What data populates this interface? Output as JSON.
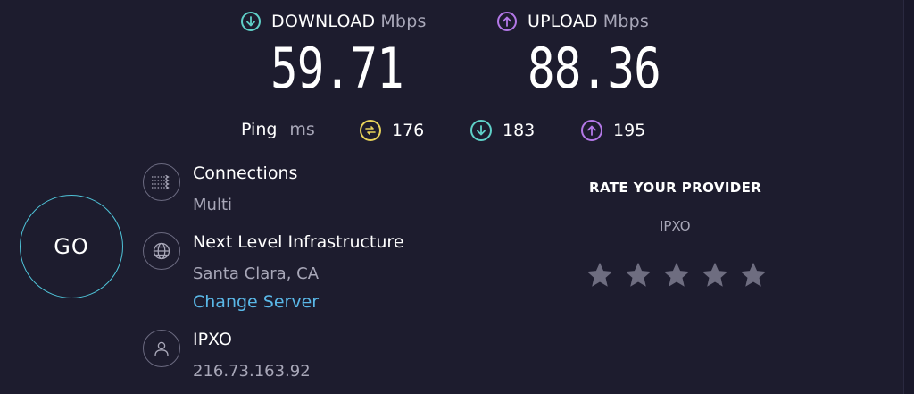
{
  "download": {
    "label": "DOWNLOAD",
    "unit": "Mbps",
    "value": "59.71",
    "color": "#5fd0c8"
  },
  "upload": {
    "label": "UPLOAD",
    "unit": "Mbps",
    "value": "88.36",
    "color": "#b478e8"
  },
  "ping": {
    "label": "Ping",
    "unit": "ms",
    "idle": {
      "value": "176",
      "color": "#e8d35a",
      "icon": "ping-idle-icon"
    },
    "download": {
      "value": "183",
      "color": "#5fd0c8",
      "icon": "arrow-down-icon"
    },
    "upload": {
      "value": "195",
      "color": "#b478e8",
      "icon": "arrow-up-icon"
    }
  },
  "go": {
    "label": "GO",
    "color": "#4fc3d8"
  },
  "connections": {
    "title": "Connections",
    "value": "Multi",
    "icon": "connections-icon"
  },
  "server": {
    "title": "Next Level Infrastructure",
    "location": "Santa Clara, CA",
    "change_label": "Change Server",
    "icon": "globe-icon"
  },
  "client": {
    "title": "IPXO",
    "ip": "216.73.163.92",
    "icon": "user-icon"
  },
  "rate": {
    "title": "RATE YOUR PROVIDER",
    "provider": "IPXO",
    "stars": 5,
    "star_color": "#6e6d80"
  }
}
